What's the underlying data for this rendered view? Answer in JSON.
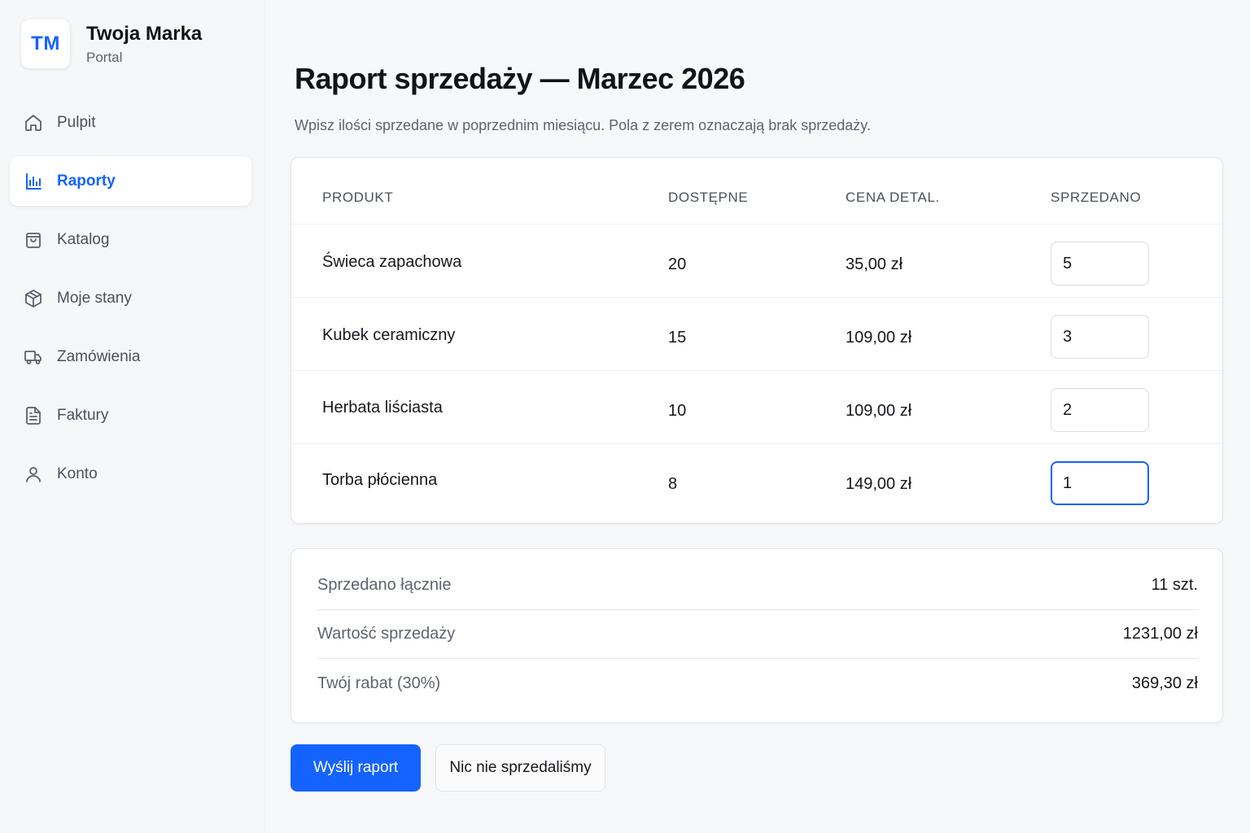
{
  "brand": {
    "logo": "TM",
    "name": "Twoja Marka",
    "subtitle": "Portal"
  },
  "nav": [
    {
      "label": "Pulpit",
      "icon": "home-icon",
      "active": false
    },
    {
      "label": "Raporty",
      "icon": "bar-chart-icon",
      "active": true
    },
    {
      "label": "Katalog",
      "icon": "shopping-bag-icon",
      "active": false
    },
    {
      "label": "Moje stany",
      "icon": "box-icon",
      "active": false
    },
    {
      "label": "Zamówienia",
      "icon": "truck-icon",
      "active": false
    },
    {
      "label": "Faktury",
      "icon": "file-text-icon",
      "active": false
    },
    {
      "label": "Konto",
      "icon": "user-icon",
      "active": false
    }
  ],
  "page": {
    "title": "Raport sprzedaży — Marzec 2026",
    "subtitle": "Wpisz ilości sprzedane w poprzednim miesiącu. Pola z zerem oznaczają brak sprzedaży."
  },
  "table": {
    "headers": [
      "PRODUKT",
      "DOSTĘPNE",
      "CENA DETAL.",
      "SPRZEDANO"
    ],
    "rows": [
      {
        "product": "Świeca zapachowa",
        "available": "20",
        "price": "35,00 zł",
        "sold": "5"
      },
      {
        "product": "Kubek ceramiczny",
        "available": "15",
        "price": "109,00 zł",
        "sold": "3"
      },
      {
        "product": "Herbata liściasta",
        "available": "10",
        "price": "109,00 zł",
        "sold": "2"
      },
      {
        "product": "Torba płócienna",
        "available": "8",
        "price": "149,00 zł",
        "sold": "1"
      }
    ]
  },
  "summary": [
    {
      "label": "Sprzedano łącznie",
      "value": "11 szt."
    },
    {
      "label": "Wartość sprzedaży",
      "value": "1231,00 zł"
    },
    {
      "label": "Twój rabat (30%)",
      "value": "369,30 zł"
    }
  ],
  "actions": {
    "submit_label": "Wyślij raport",
    "none_label": "Nic nie sprzedaliśmy"
  },
  "colors": {
    "accent": "#1463ff",
    "background": "#f7f8fa",
    "card": "#ffffff"
  }
}
